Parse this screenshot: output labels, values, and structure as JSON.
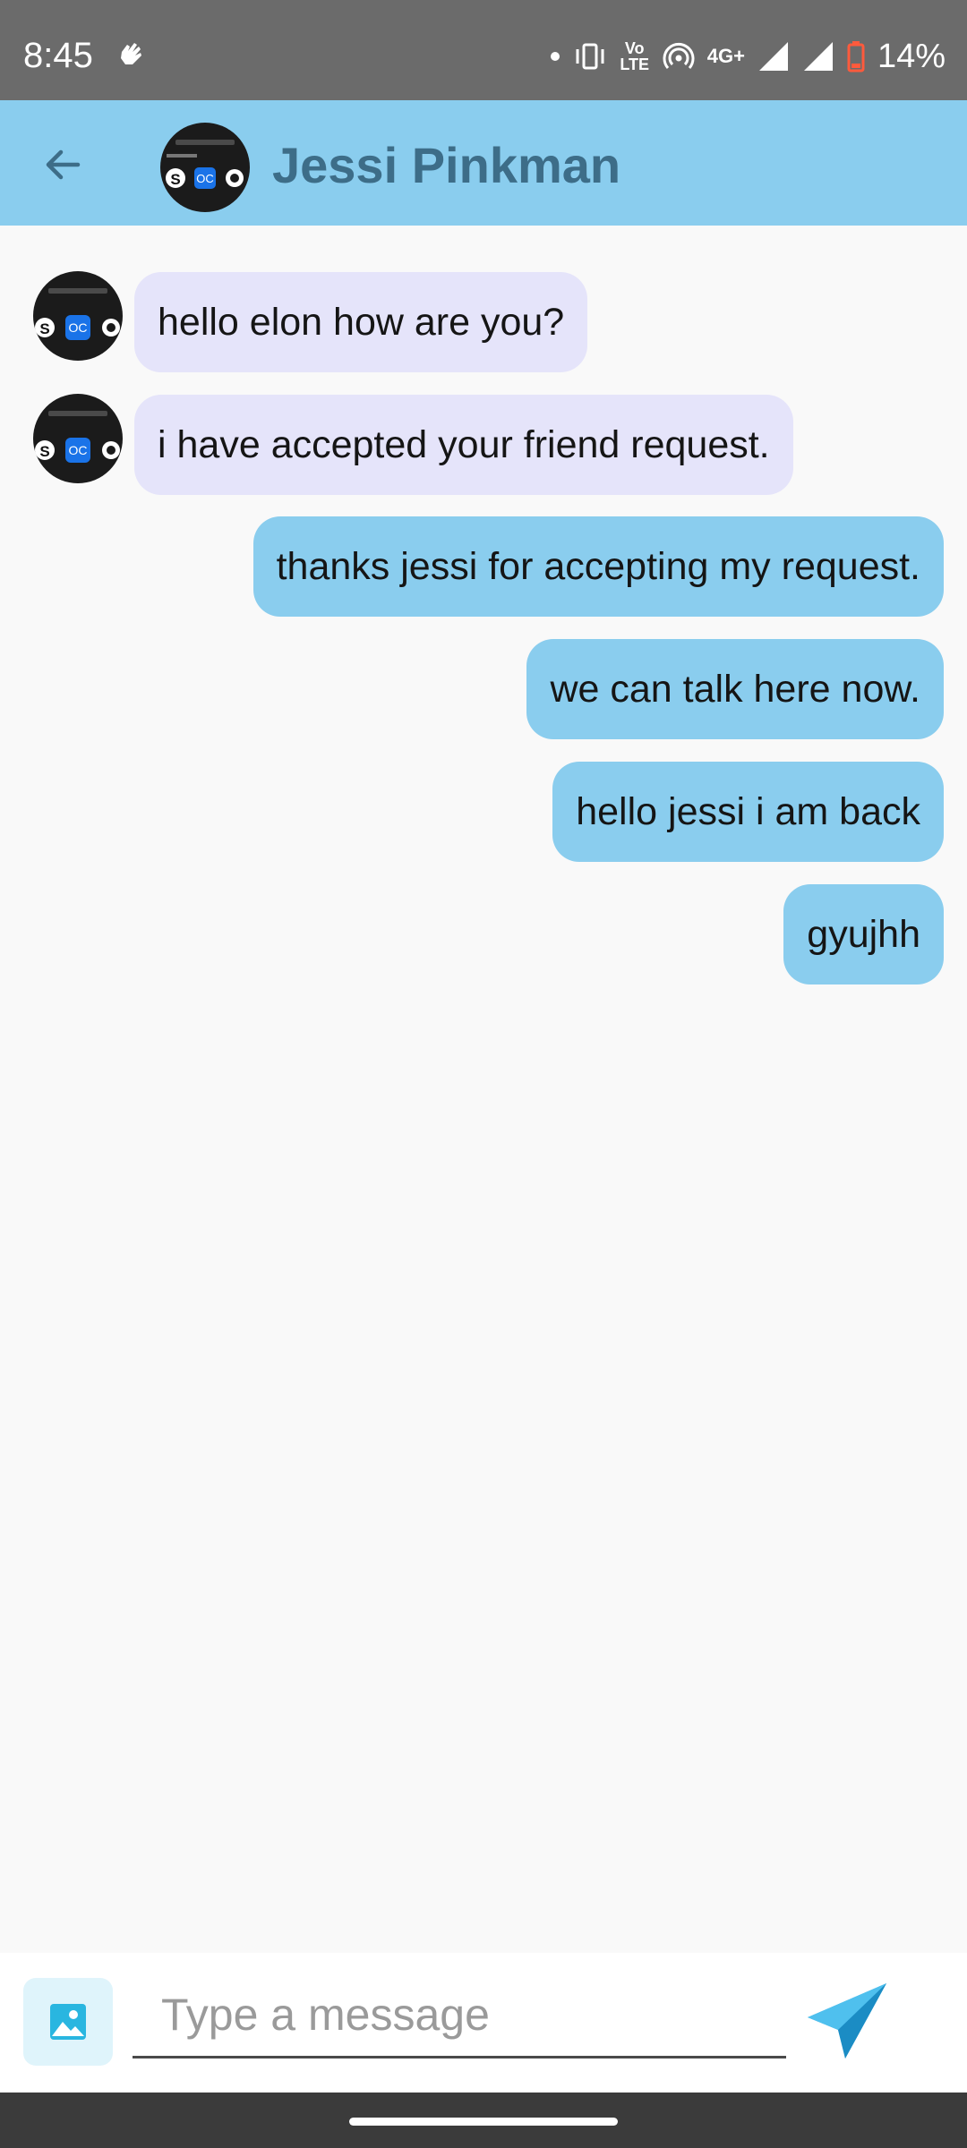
{
  "status_bar": {
    "time": "8:45",
    "network": "4G+",
    "volte": "Vo LTE",
    "battery": "14%",
    "battery_color": "#ff5a3c",
    "icons": [
      "gesture-hand-icon",
      "dot-icon",
      "vibrate-icon",
      "volte-icon",
      "hotspot-icon",
      "signal-icon",
      "signal-icon",
      "battery-low-icon"
    ]
  },
  "header": {
    "back_icon": "arrow-left-icon",
    "contact_name": "Jessi Pinkman",
    "background": "#8acdee"
  },
  "messages": [
    {
      "direction": "in",
      "text": "hello elon how are you?"
    },
    {
      "direction": "in",
      "text": "i have accepted your friend request."
    },
    {
      "direction": "out",
      "text": "thanks jessi for accepting my request."
    },
    {
      "direction": "out",
      "text": "we can talk here now."
    },
    {
      "direction": "out",
      "text": "hello jessi i am back"
    },
    {
      "direction": "out",
      "text": "gyujhh"
    }
  ],
  "composer": {
    "placeholder": "Type a message",
    "value": "",
    "image_icon": "image-icon",
    "send_icon": "send-icon"
  },
  "colors": {
    "incoming_bubble": "#e5e4fa",
    "outgoing_bubble": "#8acdee",
    "accent": "#29a8e0"
  }
}
